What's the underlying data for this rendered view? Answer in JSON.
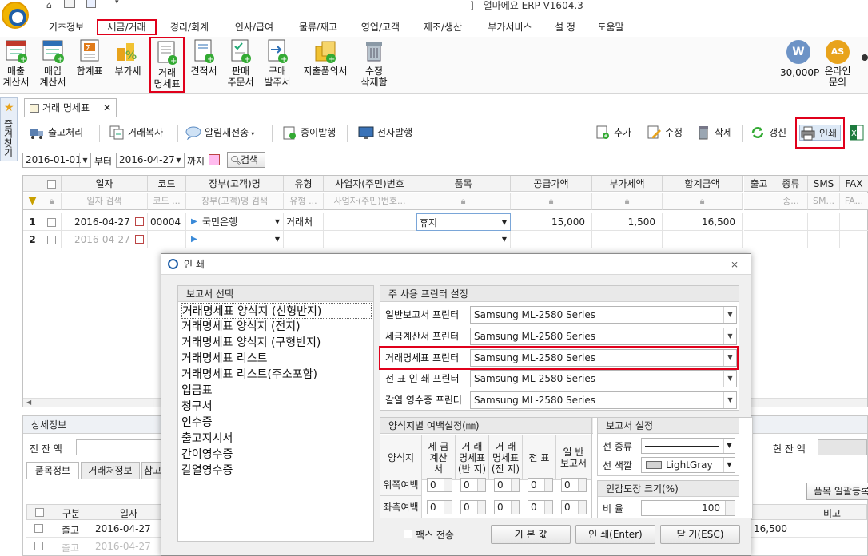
{
  "window": {
    "title": "] - 얼마에요 ERP V1604.3"
  },
  "menu": [
    "기초정보",
    "세금/거래",
    "경리/회계",
    "인사/급여",
    "물류/재고",
    "영업/고객",
    "제조/생산",
    "부가서비스",
    "설 정",
    "도움말"
  ],
  "ribbon": {
    "items": [
      {
        "label1": "매출",
        "label2": "계산서"
      },
      {
        "label1": "매입",
        "label2": "계산서"
      },
      {
        "label1": "합계표",
        "label2": ""
      },
      {
        "label1": "부가세",
        "label2": ""
      },
      {
        "label1": "거래",
        "label2": "명세표"
      },
      {
        "label1": "견적서",
        "label2": ""
      },
      {
        "label1": "판매",
        "label2": "주문서"
      },
      {
        "label1": "구매",
        "label2": "발주서"
      },
      {
        "label1": "지출품의서",
        "label2": ""
      },
      {
        "label1": "수정",
        "label2": "삭제함"
      }
    ],
    "points": "30,000P",
    "points_icon": "W",
    "online_icon": "AS",
    "online1": "온라인",
    "online2": "문의"
  },
  "sidebar": {
    "favorites": "즐겨찾기"
  },
  "doc_tab": {
    "label": "거래 명세표"
  },
  "toolbar": {
    "ship": "출고처리",
    "copy": "거래복사",
    "resend": "알림재전송",
    "paper": "종이발행",
    "electronic": "전자발행",
    "add": "추가",
    "edit": "수정",
    "delete": "삭제",
    "refresh": "갱신",
    "print": "인쇄"
  },
  "filter": {
    "from": "2016-01-01",
    "from_suffix": "부터",
    "to": "2016-04-27",
    "to_suffix": "까지",
    "search": "검색"
  },
  "grid": {
    "headers": [
      "일자",
      "코드",
      "장부(고객)명",
      "유형",
      "사업자(주민)번호",
      "품목",
      "공급가액",
      "부가세액",
      "합계금액",
      "출고",
      "종류",
      "SMS",
      "FAX"
    ],
    "filters": [
      "일자 검색",
      "코드 ...",
      "장부(고객)명 검색",
      "유형 ...",
      "사업자(주민)번호...",
      "",
      "",
      "",
      "",
      "",
      "종...",
      "SM...",
      "FA..."
    ],
    "rows": [
      {
        "no": "1",
        "date": "2016-04-27",
        "code": "00004",
        "name": "국민은행",
        "type": "거래처",
        "bizno": "",
        "item": "휴지",
        "supply": "15,000",
        "vat": "1,500",
        "total": "16,500"
      },
      {
        "no": "2",
        "date": "2016-04-27",
        "code": "",
        "name": "",
        "type": "",
        "bizno": "",
        "item": "",
        "supply": "",
        "vat": "",
        "total": ""
      }
    ]
  },
  "detail": {
    "title": "상세정보",
    "prev_balance": "전 잔 액",
    "curr_balance": "현 잔 액",
    "tabs": [
      "품목정보",
      "거래처정보",
      "참고"
    ],
    "bulk_button": "품목 일괄등록",
    "headers": [
      "구분",
      "일자",
      "비고"
    ],
    "rows": [
      {
        "kind": "출고",
        "date": "2016-04-27",
        "amount": "16,500"
      },
      {
        "kind": "출고",
        "date": "2016-04-27",
        "amount": ""
      }
    ]
  },
  "dialog": {
    "title": "인 쇄",
    "report_group": "보고서 선택",
    "reports": [
      "거래명세표 양식지 (신형반지)",
      "거래명세표 양식지 (전지)",
      "거래명세표 양식지 (구형반지)",
      "거래명세표 리스트",
      "거래명세표 리스트(주소포함)",
      "입금표",
      "청구서",
      "인수증",
      "출고지시서",
      "간이영수증",
      "갈열영수증"
    ],
    "printer_group": "주 사용 프린터 설정",
    "printers": [
      {
        "label": "일반보고서 프린터",
        "value": "Samsung ML-2580 Series"
      },
      {
        "label": "세금계산서 프린터",
        "value": "Samsung ML-2580 Series"
      },
      {
        "label": "거래명세표 프린터",
        "value": "Samsung ML-2580 Series"
      },
      {
        "label": "전 표 인 쇄 프린터",
        "value": "Samsung ML-2580 Series"
      },
      {
        "label": "갈열 영수증 프린터",
        "value": "Samsung ML-2580 Series"
      }
    ],
    "margin_group": "양식지별 여백설정(㎜)",
    "margin_headers": [
      "양식지",
      "세 금 계산서",
      "거 래 명세표 (반 지)",
      "거 래 명세표 (전 지)",
      "전 표",
      "일 반 보고서"
    ],
    "margin_rows": [
      {
        "label": "위쪽여백",
        "values": [
          "0",
          "0",
          "0",
          "0",
          "0"
        ]
      },
      {
        "label": "좌측여백",
        "values": [
          "0",
          "0",
          "0",
          "0",
          "0"
        ]
      }
    ],
    "report_settings": "보고서 설정",
    "line_type": "선 종류",
    "line_color": "선 색깔",
    "line_color_value": "LightGray",
    "line_color_hex": "#d3d3d3",
    "stamp_group": "인감도장 크기(%)",
    "ratio_label": "비 율",
    "ratio_value": "100",
    "fax_send": "팩스 전송",
    "btn_default": "기 본 값",
    "btn_print": "인 쇄(Enter)",
    "btn_close": "닫 기(ESC)"
  }
}
